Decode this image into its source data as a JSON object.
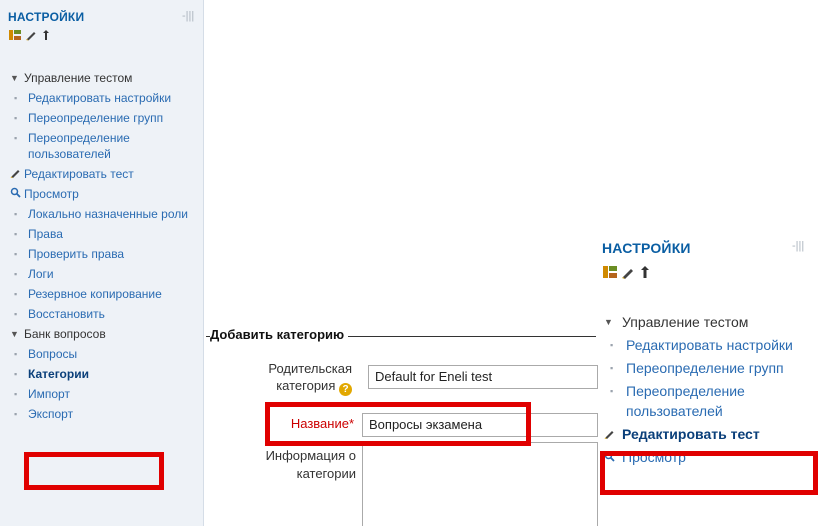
{
  "left_block": {
    "title": "НАСТРОЙКИ",
    "collapse": "-|||",
    "items": [
      {
        "label": "Управление тестом",
        "kind": "group"
      },
      {
        "label": "Редактировать настройки",
        "kind": "link"
      },
      {
        "label": "Переопределение групп",
        "kind": "link"
      },
      {
        "label": "Переопределение пользователей",
        "kind": "link"
      },
      {
        "label": "Редактировать тест",
        "kind": "edit"
      },
      {
        "label": "Просмотр",
        "kind": "search"
      },
      {
        "label": "Локально назначенные роли",
        "kind": "link"
      },
      {
        "label": "Права",
        "kind": "link"
      },
      {
        "label": "Проверить права",
        "kind": "link"
      },
      {
        "label": "Логи",
        "kind": "link"
      },
      {
        "label": "Резервное копирование",
        "kind": "link"
      },
      {
        "label": "Восстановить",
        "kind": "link"
      },
      {
        "label": "Банк вопросов",
        "kind": "group"
      },
      {
        "label": "Вопросы",
        "kind": "link"
      },
      {
        "label": "Категории",
        "kind": "bold"
      },
      {
        "label": "Импорт",
        "kind": "link"
      },
      {
        "label": "Экспорт",
        "kind": "link"
      }
    ]
  },
  "right_block": {
    "title": "НАСТРОЙКИ",
    "collapse": "-|||",
    "items": [
      {
        "label": "Управление тестом",
        "kind": "group"
      },
      {
        "label": "Редактировать настройки",
        "kind": "link"
      },
      {
        "label": "Переопределение групп",
        "kind": "link"
      },
      {
        "label": "Переопределение пользователей",
        "kind": "link"
      },
      {
        "label": "Редактировать тест",
        "kind": "edit-bold"
      },
      {
        "label": "Просмотр",
        "kind": "search"
      }
    ]
  },
  "form": {
    "legend": "Добавить категорию",
    "parent_label_1": "Родительская",
    "parent_label_2": "категория",
    "parent_value": "Default for Eneli test",
    "name_label": "Название",
    "name_required": "*",
    "name_value": "Вопросы экзамена",
    "info_label_1": "Информация о",
    "info_label_2": "категории"
  },
  "colors": {
    "accent": "#0a5ea3",
    "highlight": "#e00000",
    "link": "#2a6bb2"
  }
}
